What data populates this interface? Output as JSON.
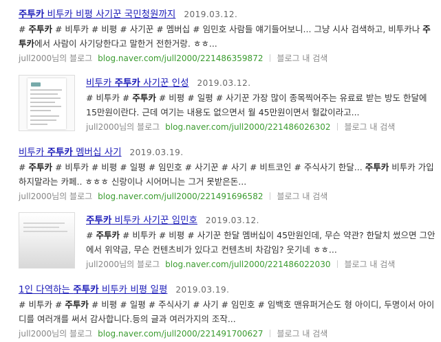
{
  "results": [
    {
      "title_bold": "주투카",
      "title_rest": " 비투카 비평 사기꾼 국민청원까지",
      "date": "2019.03.12.",
      "desc_segments": [
        {
          "t": "# ",
          "b": false
        },
        {
          "t": "주투카",
          "b": true
        },
        {
          "t": " # 비투카 # 비평 # 사기꾼 # 멤버십 # 임민호 사람들 얘기들어보니... 그냥 시사 검색하고, 비투카나 ",
          "b": false
        },
        {
          "t": "주투카",
          "b": true
        },
        {
          "t": "에서 사람이 사기당한다고 말한거 전한거랑. ㅎㅎ...",
          "b": false
        }
      ],
      "author": "jull2000님의 블로그",
      "url": "blog.naver.com/jull2000/221486359872",
      "search_label": "블로그 내 검색"
    },
    {
      "title_pre": "비투카 ",
      "title_bold": "주투카",
      "title_rest": " 사기꾼 인성",
      "date": "2019.03.12.",
      "desc_segments": [
        {
          "t": "# 비투카 # ",
          "b": false
        },
        {
          "t": "주투카",
          "b": true
        },
        {
          "t": " # 비평 # 일평 # 사기꾼 가장 많이 종목찍어주는 유료료 받는 방도 한달에 15만원이란다. 근데 여기는 내용도 없으면서 월 45만원이면서 헐값이라고...",
          "b": false
        }
      ],
      "author": "jull2000님의 블로그",
      "url": "blog.naver.com/jull2000/221486026302",
      "search_label": "블로그 내 검색"
    },
    {
      "title_pre": "비투카 ",
      "title_bold": "주투카",
      "title_rest": " 멤버십 사기",
      "date": "2019.03.19.",
      "desc_segments": [
        {
          "t": "# ",
          "b": false
        },
        {
          "t": "주투카",
          "b": true
        },
        {
          "t": " # 비투카 # 비평 # 일평 # 임민호 # 사기꾼 # 사기 # 비트코인 # 주식사기 한달... ",
          "b": false
        },
        {
          "t": "주투카",
          "b": true
        },
        {
          "t": " 비투카 가입하지말라는 카페.. ㅎㅎㅎ 신랑이나 시어머니는 그거 못받은돈...",
          "b": false
        }
      ],
      "author": "jull2000님의 블로그",
      "url": "blog.naver.com/jull2000/221491696582",
      "search_label": "블로그 내 검색"
    },
    {
      "title_bold": "주투카",
      "title_rest": " 비투카 사기꾼 임민호",
      "date": "2019.03.12.",
      "desc_segments": [
        {
          "t": "# ",
          "b": false
        },
        {
          "t": "주투카",
          "b": true
        },
        {
          "t": " # 비투카 # 비평 # 사기꾼 한달 멤버십이 45만원인데, 무슨 약관? 한달치 썼으면 그안에서 위약금, 무슨 컨텐츠비가 있다고 컨텐츠비 차감임? 웃기네 ㅎㅎ...",
          "b": false
        }
      ],
      "author": "jull2000님의 블로그",
      "url": "blog.naver.com/jull2000/221486022030",
      "search_label": "블로그 내 검색"
    },
    {
      "title_pre": "1인 다역하는 ",
      "title_bold": "주투카",
      "title_rest": " 비투카 비평 일평",
      "date": "2019.03.19.",
      "desc_segments": [
        {
          "t": "# 비투카 # ",
          "b": false
        },
        {
          "t": "주투카",
          "b": true
        },
        {
          "t": " # 비평 # 일평 # 주식사기 # 사기 # 임민호 # 임백호 맨유퍼거슨도 형 아이디, 두명이서 아이디를 여러개를 써서 감사합니다.등의 글과 여러가지의 조작...",
          "b": false
        }
      ],
      "author": "jull2000님의 블로그",
      "url": "blog.naver.com/jull2000/221491700627",
      "search_label": "블로그 내 검색"
    }
  ]
}
